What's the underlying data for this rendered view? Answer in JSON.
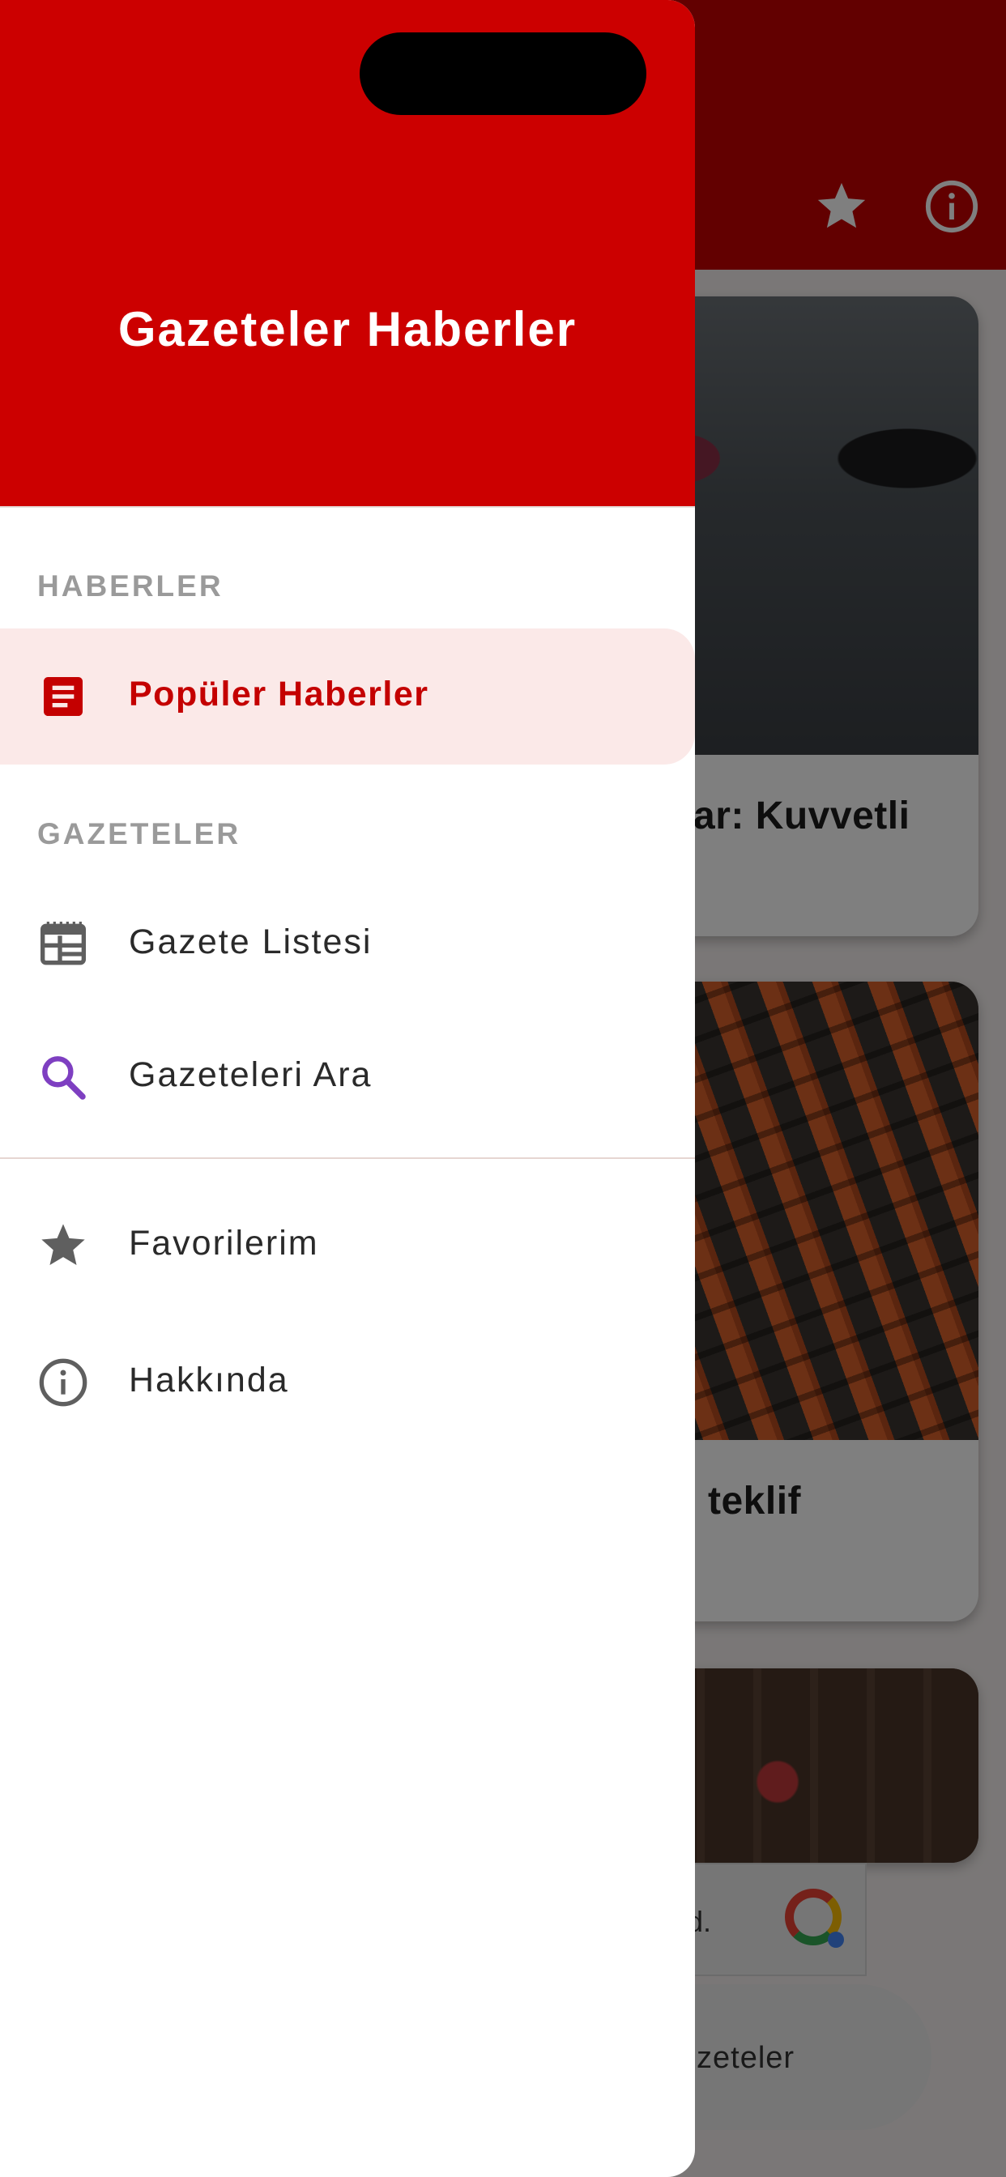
{
  "background": {
    "cards": [
      {
        "title_fragment": "ar: Kuvvetli"
      },
      {
        "title_fragment": "teklif"
      }
    ],
    "ad_text_fragment": "d.",
    "bottom_pill_fragment": "zeteler"
  },
  "drawer": {
    "title": "Gazeteler Haberler",
    "sections": {
      "news_label": "HABERLER",
      "papers_label": "GAZETELER"
    },
    "items": {
      "popular": "Popüler Haberler",
      "list": "Gazete Listesi",
      "search": "Gazeteleri Ara",
      "favorites": "Favorilerim",
      "about": "Hakkında"
    }
  },
  "colors": {
    "brand_red": "#cc0000",
    "selected_bg": "#fbe9e8",
    "search_icon": "#7e3fc1",
    "icon_gray": "#5f5f5f",
    "section_label": "#9a9a9a"
  }
}
